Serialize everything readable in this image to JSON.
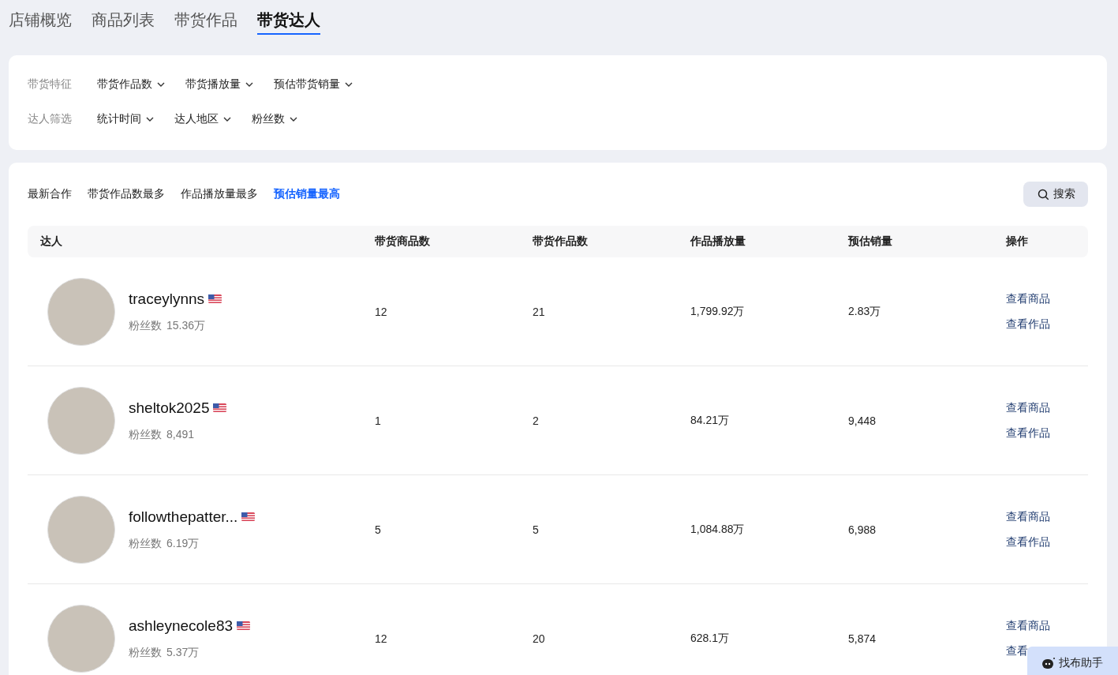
{
  "tabs": [
    {
      "label": "店铺概览",
      "selected": false
    },
    {
      "label": "商品列表",
      "selected": false
    },
    {
      "label": "带货作品",
      "selected": false
    },
    {
      "label": "带货达人",
      "selected": true
    }
  ],
  "filters": [
    {
      "label": "带货特征",
      "options": [
        "带货作品数",
        "带货播放量",
        "预估带货销量"
      ]
    },
    {
      "label": "达人筛选",
      "options": [
        "统计时间",
        "达人地区",
        "粉丝数"
      ]
    }
  ],
  "sort_tabs": [
    {
      "label": "最新合作",
      "selected": false
    },
    {
      "label": "带货作品数最多",
      "selected": false
    },
    {
      "label": "作品播放量最多",
      "selected": false
    },
    {
      "label": "预估销量最高",
      "selected": true
    }
  ],
  "search_button": "搜索",
  "table": {
    "columns": [
      "达人",
      "带货商品数",
      "带货作品数",
      "作品播放量",
      "预估销量",
      "操作"
    ],
    "rows": [
      {
        "name": "traceylynns",
        "followers_label": "粉丝数",
        "followers": "15.36万",
        "products": "12",
        "works": "21",
        "plays": "1,799.92万",
        "sales": "2.83万",
        "actions": [
          "查看商品",
          "查看作品"
        ]
      },
      {
        "name": "sheltok2025",
        "followers_label": "粉丝数",
        "followers": "8,491",
        "products": "1",
        "works": "2",
        "plays": "84.21万",
        "sales": "9,448",
        "actions": [
          "查看商品",
          "查看作品"
        ]
      },
      {
        "name": "followthepatter...",
        "followers_label": "粉丝数",
        "followers": "6.19万",
        "products": "5",
        "works": "5",
        "plays": "1,084.88万",
        "sales": "6,988",
        "actions": [
          "查看商品",
          "查看作品"
        ]
      },
      {
        "name": "ashleynecole83",
        "followers_label": "粉丝数",
        "followers": "5.37万",
        "products": "12",
        "works": "20",
        "plays": "628.1万",
        "sales": "5,874",
        "actions": [
          "查看商品",
          "查看"
        ]
      }
    ]
  },
  "helper_button": "找布助手"
}
